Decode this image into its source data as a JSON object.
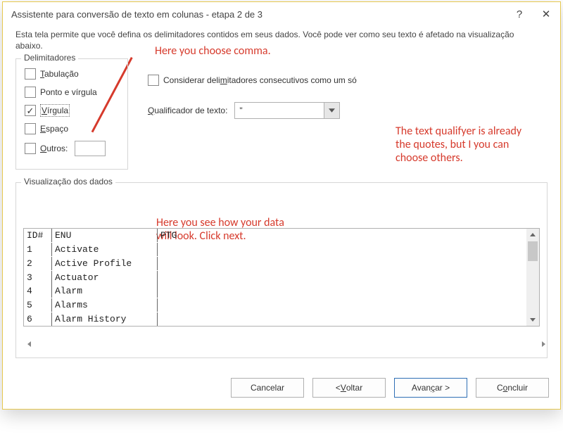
{
  "title": "Assistente para conversão de texto em colunas - etapa 2 de 3",
  "help_glyph": "?",
  "close_glyph": "✕",
  "description": "Esta tela permite que você defina os delimitadores contidos em seus dados. Você pode ver como seu texto é afetado na visualização abaixo.",
  "delimiters": {
    "legend": "Delimitadores",
    "tab_pre": "T",
    "tab_post": "abulação",
    "semicolon_pre": "Ponto e vír",
    "semicolon_uchar": "g",
    "semicolon_post": "ula",
    "comma_pre": "V",
    "comma_post": "írgula",
    "space_pre": "E",
    "space_post": "spaço",
    "other_pre": "O",
    "other_post": "utros:",
    "other_value": ""
  },
  "consecutive_pre": "Considerar deli",
  "consecutive_uchar": "m",
  "consecutive_post": "itadores consecutivos como um só",
  "qualifier": {
    "label_pre": "Q",
    "label_post": "ualificador de texto:",
    "value": "\""
  },
  "preview": {
    "legend": "Visualização dos dados",
    "rows": [
      {
        "c1": "ID#",
        "c2": "ENU",
        "c3": "PTG"
      },
      {
        "c1": "1",
        "c2": "Activate",
        "c3": ""
      },
      {
        "c1": "2",
        "c2": "Active Profile",
        "c3": ""
      },
      {
        "c1": "3",
        "c2": "Actuator",
        "c3": ""
      },
      {
        "c1": "4",
        "c2": "Alarm",
        "c3": ""
      },
      {
        "c1": "5",
        "c2": "Alarms",
        "c3": ""
      },
      {
        "c1": "6",
        "c2": "Alarm History",
        "c3": ""
      }
    ]
  },
  "buttons": {
    "cancel": "Cancelar",
    "back_pre": "< ",
    "back_u": "V",
    "back_post": "oltar",
    "next_pre": "Avan",
    "next_u": "ç",
    "next_post": "ar >",
    "finish_pre": "C",
    "finish_u": "o",
    "finish_post": "ncluir"
  },
  "annotations": {
    "a1": "Here you choose comma.",
    "a2": "The text qualifyer is already the quotes, but I you can choose others.",
    "a3": "Here you see how your data will look. Click next."
  }
}
